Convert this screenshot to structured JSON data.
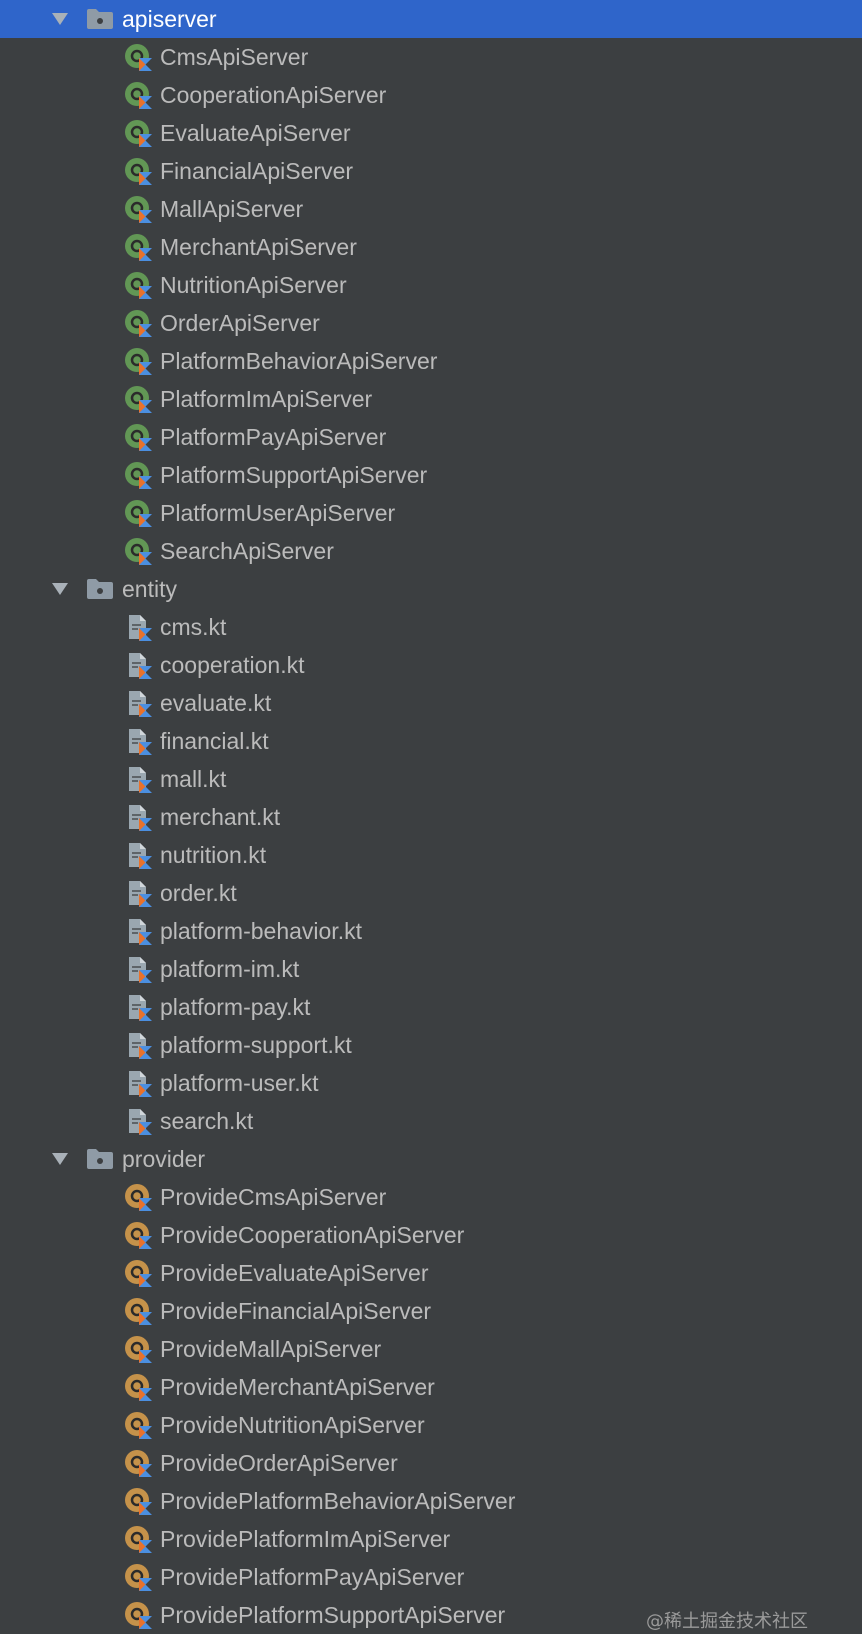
{
  "colors": {
    "background": "#3c3f41",
    "selection": "#2f65ca",
    "text": "#bbbbbb",
    "selected_text": "#ffffff",
    "object_icon_green": "#629755",
    "provider_icon_orange": "#c5924a",
    "kotlin_blue": "#4b8fe0",
    "kotlin_orange": "#e8722c",
    "folder_gray": "#8f9ba6"
  },
  "tree": {
    "groups": [
      {
        "name": "apiserver",
        "expanded": true,
        "selected": true,
        "icon": "package-folder-icon",
        "items": [
          {
            "label": "CmsApiServer",
            "icon": "kotlin-object-icon"
          },
          {
            "label": "CooperationApiServer",
            "icon": "kotlin-object-icon"
          },
          {
            "label": "EvaluateApiServer",
            "icon": "kotlin-object-icon"
          },
          {
            "label": "FinancialApiServer",
            "icon": "kotlin-object-icon"
          },
          {
            "label": "MallApiServer",
            "icon": "kotlin-object-icon"
          },
          {
            "label": "MerchantApiServer",
            "icon": "kotlin-object-icon"
          },
          {
            "label": "NutritionApiServer",
            "icon": "kotlin-object-icon"
          },
          {
            "label": "OrderApiServer",
            "icon": "kotlin-object-icon"
          },
          {
            "label": "PlatformBehaviorApiServer",
            "icon": "kotlin-object-icon"
          },
          {
            "label": "PlatformImApiServer",
            "icon": "kotlin-object-icon"
          },
          {
            "label": "PlatformPayApiServer",
            "icon": "kotlin-object-icon"
          },
          {
            "label": "PlatformSupportApiServer",
            "icon": "kotlin-object-icon"
          },
          {
            "label": "PlatformUserApiServer",
            "icon": "kotlin-object-icon"
          },
          {
            "label": "SearchApiServer",
            "icon": "kotlin-object-icon"
          }
        ]
      },
      {
        "name": "entity",
        "expanded": true,
        "selected": false,
        "icon": "package-folder-icon",
        "items": [
          {
            "label": "cms.kt",
            "icon": "kotlin-file-icon"
          },
          {
            "label": "cooperation.kt",
            "icon": "kotlin-file-icon"
          },
          {
            "label": "evaluate.kt",
            "icon": "kotlin-file-icon"
          },
          {
            "label": "financial.kt",
            "icon": "kotlin-file-icon"
          },
          {
            "label": "mall.kt",
            "icon": "kotlin-file-icon"
          },
          {
            "label": "merchant.kt",
            "icon": "kotlin-file-icon"
          },
          {
            "label": "nutrition.kt",
            "icon": "kotlin-file-icon"
          },
          {
            "label": "order.kt",
            "icon": "kotlin-file-icon"
          },
          {
            "label": "platform-behavior.kt",
            "icon": "kotlin-file-icon"
          },
          {
            "label": "platform-im.kt",
            "icon": "kotlin-file-icon"
          },
          {
            "label": "platform-pay.kt",
            "icon": "kotlin-file-icon"
          },
          {
            "label": "platform-support.kt",
            "icon": "kotlin-file-icon"
          },
          {
            "label": "platform-user.kt",
            "icon": "kotlin-file-icon"
          },
          {
            "label": "search.kt",
            "icon": "kotlin-file-icon"
          }
        ]
      },
      {
        "name": "provider",
        "expanded": true,
        "selected": false,
        "icon": "package-folder-icon",
        "items": [
          {
            "label": "ProvideCmsApiServer",
            "icon": "kotlin-provider-icon"
          },
          {
            "label": "ProvideCooperationApiServer",
            "icon": "kotlin-provider-icon"
          },
          {
            "label": "ProvideEvaluateApiServer",
            "icon": "kotlin-provider-icon"
          },
          {
            "label": "ProvideFinancialApiServer",
            "icon": "kotlin-provider-icon"
          },
          {
            "label": "ProvideMallApiServer",
            "icon": "kotlin-provider-icon"
          },
          {
            "label": "ProvideMerchantApiServer",
            "icon": "kotlin-provider-icon"
          },
          {
            "label": "ProvideNutritionApiServer",
            "icon": "kotlin-provider-icon"
          },
          {
            "label": "ProvideOrderApiServer",
            "icon": "kotlin-provider-icon"
          },
          {
            "label": "ProvidePlatformBehaviorApiServer",
            "icon": "kotlin-provider-icon"
          },
          {
            "label": "ProvidePlatformImApiServer",
            "icon": "kotlin-provider-icon"
          },
          {
            "label": "ProvidePlatformPayApiServer",
            "icon": "kotlin-provider-icon"
          },
          {
            "label": "ProvidePlatformSupportApiServer",
            "icon": "kotlin-provider-icon"
          }
        ]
      }
    ]
  },
  "watermark": "@稀土掘金技术社区"
}
